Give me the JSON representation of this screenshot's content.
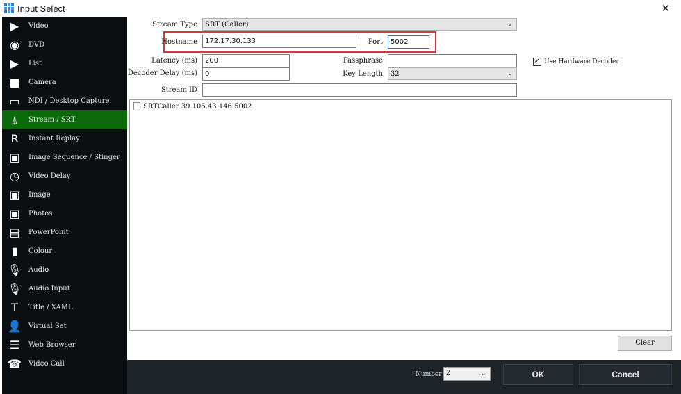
{
  "window": {
    "title": "Input Select",
    "close_label": "✕"
  },
  "sidebar": {
    "items": [
      {
        "label": "Video",
        "icon": "video-icon",
        "glyph": "▶"
      },
      {
        "label": "DVD",
        "icon": "dvd-icon",
        "glyph": "◉"
      },
      {
        "label": "List",
        "icon": "list-icon",
        "glyph": "▶"
      },
      {
        "label": "Camera",
        "icon": "camera-icon",
        "glyph": "■"
      },
      {
        "label": "NDI / Desktop Capture",
        "icon": "monitor-icon",
        "glyph": "▭"
      },
      {
        "label": "Stream / SRT",
        "icon": "antenna-icon",
        "glyph": "⍋"
      },
      {
        "label": "Instant Replay",
        "icon": "replay-icon",
        "glyph": "R"
      },
      {
        "label": "Image Sequence / Stinger",
        "icon": "image-sequence-icon",
        "glyph": "▣"
      },
      {
        "label": "Video Delay",
        "icon": "clock-icon",
        "glyph": "◷"
      },
      {
        "label": "Image",
        "icon": "image-icon",
        "glyph": "▣"
      },
      {
        "label": "Photos",
        "icon": "photos-icon",
        "glyph": "▣"
      },
      {
        "label": "PowerPoint",
        "icon": "presentation-icon",
        "glyph": "▤"
      },
      {
        "label": "Colour",
        "icon": "colour-icon",
        "glyph": "▮"
      },
      {
        "label": "Audio",
        "icon": "microphone-icon",
        "glyph": "🎙"
      },
      {
        "label": "Audio Input",
        "icon": "microphone-icon",
        "glyph": "🎙"
      },
      {
        "label": "Title / XAML",
        "icon": "title-icon",
        "glyph": "T"
      },
      {
        "label": "Virtual Set",
        "icon": "person-icon",
        "glyph": "👤"
      },
      {
        "label": "Web Browser",
        "icon": "browser-icon",
        "glyph": "☰"
      },
      {
        "label": "Video Call",
        "icon": "video-call-icon",
        "glyph": "☎"
      }
    ],
    "selected": "Stream / SRT",
    "selected_color": "#0b6b0b"
  },
  "form": {
    "stream_type_label": "Stream Type",
    "stream_type_value": "SRT (Caller)",
    "hostname_label": "Hostname",
    "hostname_value": "172.17.30.133",
    "port_label": "Port",
    "port_value": "5002",
    "latency_label": "Latency (ms)",
    "latency_value": "200",
    "passphrase_label": "Passphrase",
    "passphrase_value": "",
    "decoder_delay_label": "Decoder Delay (ms)",
    "decoder_delay_value": "0",
    "key_length_label": "Key Length",
    "key_length_value": "32",
    "stream_id_label": "Stream ID",
    "stream_id_value": "",
    "hw_decoder_label": "Use Hardware Decoder",
    "hw_decoder_checked": true,
    "check_glyph": "✓",
    "chevron": "⌄",
    "highlight_color": "#d33a3a"
  },
  "list": {
    "items": [
      "SRTCaller 39.105.43.146 5002"
    ]
  },
  "buttons": {
    "clear": "Clear",
    "ok": "OK",
    "cancel": "Cancel"
  },
  "footer": {
    "number_label": "Number",
    "number_value": "2"
  }
}
